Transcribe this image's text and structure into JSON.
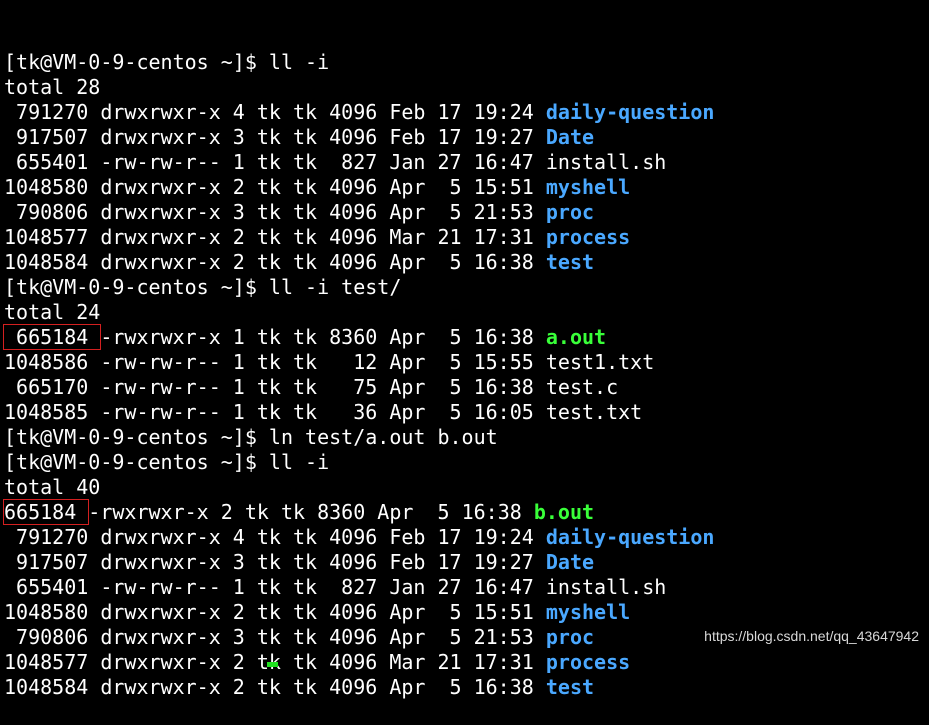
{
  "terminal": {
    "lines": [
      {
        "kind": "prompt",
        "text": "[tk@VM-0-9-centos ~]$ ll -i"
      },
      {
        "kind": "plain",
        "text": "total 28"
      },
      {
        "kind": "entry",
        "pre": " 791270 drwxrwxr-x 4 tk tk 4096 Feb 17 19:24 ",
        "name": "daily-question",
        "style": "dir"
      },
      {
        "kind": "entry",
        "pre": " 917507 drwxrwxr-x 3 tk tk 4096 Feb 17 19:27 ",
        "name": "Date",
        "style": "dir"
      },
      {
        "kind": "entry",
        "pre": " 655401 -rw-rw-r-- 1 tk tk  827 Jan 27 16:47 ",
        "name": "install.sh",
        "style": "plain"
      },
      {
        "kind": "entry",
        "pre": "1048580 drwxrwxr-x 2 tk tk 4096 Apr  5 15:51 ",
        "name": "myshell",
        "style": "dir"
      },
      {
        "kind": "entry",
        "pre": " 790806 drwxrwxr-x 3 tk tk 4096 Apr  5 21:53 ",
        "name": "proc",
        "style": "dir"
      },
      {
        "kind": "entry",
        "pre": "1048577 drwxrwxr-x 2 tk tk 4096 Mar 21 17:31 ",
        "name": "process",
        "style": "dir"
      },
      {
        "kind": "entry",
        "pre": "1048584 drwxrwxr-x 2 tk tk 4096 Apr  5 16:38 ",
        "name": "test",
        "style": "dir"
      },
      {
        "kind": "prompt",
        "text": "[tk@VM-0-9-centos ~]$ ll -i test/"
      },
      {
        "kind": "plain",
        "text": "total 24"
      },
      {
        "kind": "entry-hl",
        "inode": " 665184 ",
        "pre": "-rwxrwxr-x 1 tk tk 8360 Apr  5 16:38 ",
        "name": "a.out",
        "style": "exe"
      },
      {
        "kind": "entry",
        "pre": "1048586 -rw-rw-r-- 1 tk tk   12 Apr  5 15:55 ",
        "name": "test1.txt",
        "style": "plain"
      },
      {
        "kind": "entry",
        "pre": " 665170 -rw-rw-r-- 1 tk tk   75 Apr  5 16:38 ",
        "name": "test.c",
        "style": "plain"
      },
      {
        "kind": "entry",
        "pre": "1048585 -rw-rw-r-- 1 tk tk   36 Apr  5 16:05 ",
        "name": "test.txt",
        "style": "plain"
      },
      {
        "kind": "prompt",
        "text": "[tk@VM-0-9-centos ~]$ ln test/a.out b.out"
      },
      {
        "kind": "prompt",
        "text": "[tk@VM-0-9-centos ~]$ ll -i"
      },
      {
        "kind": "plain",
        "text": "total 40"
      },
      {
        "kind": "entry-hl",
        "inode": "665184 ",
        "pre": "-rwxrwxr-x 2 tk tk 8360 Apr  5 16:38 ",
        "name": "b.out",
        "style": "exe"
      },
      {
        "kind": "entry",
        "pre": " 791270 drwxrwxr-x 4 tk tk 4096 Feb 17 19:24 ",
        "name": "daily-question",
        "style": "dir"
      },
      {
        "kind": "entry",
        "pre": " 917507 drwxrwxr-x 3 tk tk 4096 Feb 17 19:27 ",
        "name": "Date",
        "style": "dir"
      },
      {
        "kind": "entry",
        "pre": " 655401 -rw-rw-r-- 1 tk tk  827 Jan 27 16:47 ",
        "name": "install.sh",
        "style": "plain"
      },
      {
        "kind": "entry",
        "pre": "1048580 drwxrwxr-x 2 tk tk 4096 Apr  5 15:51 ",
        "name": "myshell",
        "style": "dir"
      },
      {
        "kind": "entry",
        "pre": " 790806 drwxrwxr-x 3 tk tk 4096 Apr  5 21:53 ",
        "name": "proc",
        "style": "dir"
      },
      {
        "kind": "entry",
        "pre": "1048577 drwxrwxr-x 2 tk tk 4096 Mar 21 17:31 ",
        "name": "process",
        "style": "dir"
      },
      {
        "kind": "entry",
        "pre": "1048584 drwxrwxr-x 2 tk tk 4096 Apr  5 16:38 ",
        "name": "test",
        "style": "dir"
      }
    ]
  },
  "watermark": "https://blog.csdn.net/qq_43647942",
  "colors": {
    "background": "#000000",
    "text": "#ffffff",
    "directory": "#4aa8ff",
    "executable": "#39ff39",
    "highlight_box": "#d42020",
    "cursor": "#20e020"
  }
}
